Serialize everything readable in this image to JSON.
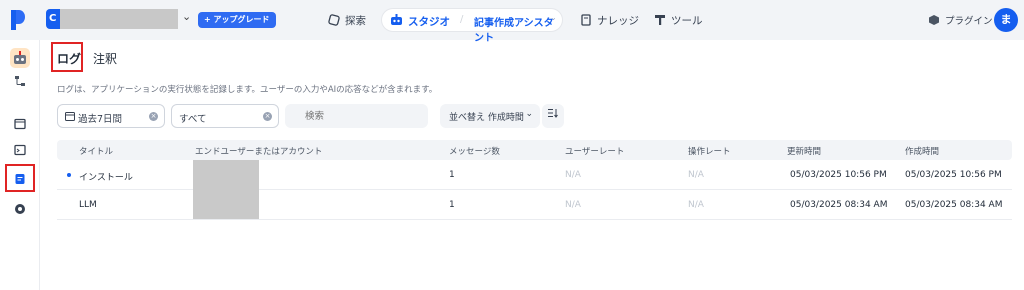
{
  "header": {
    "workspace_initial": "C",
    "upgrade_label": "+ アップグレード",
    "nav": {
      "explore": "探索",
      "studio": "スタジオ",
      "app_name": "記事作成アシスタント",
      "knowledge": "ナレッジ",
      "tools": "ツール",
      "plugins": "プラグイン"
    },
    "avatar_initial": "ま"
  },
  "tabs": [
    "ログ",
    "注釈"
  ],
  "description": "ログは、アプリケーションの実行状態を記録します。ユーザーの入力やAIの応答などが含まれます。",
  "filters": {
    "period": "過去7日間",
    "status": "すべて",
    "search_placeholder": "検索",
    "sort_label": "並べ替え 作成時間"
  },
  "table": {
    "columns": [
      "タイトル",
      "エンドユーザーまたはアカウント",
      "メッセージ数",
      "ユーザーレート",
      "操作レート",
      "更新時間",
      "作成時間"
    ],
    "rows": [
      {
        "title": "インストール",
        "user": "",
        "messages": "1",
        "user_rate": "N/A",
        "op_rate": "N/A",
        "updated": "05/03/2025 10:56 PM",
        "created": "05/03/2025 10:56 PM",
        "unread": true
      },
      {
        "title": "LLM",
        "user": "",
        "messages": "1",
        "user_rate": "N/A",
        "op_rate": "N/A",
        "updated": "05/03/2025 08:34 AM",
        "created": "05/03/2025 08:34 AM",
        "unread": false
      }
    ]
  },
  "colors": {
    "accent": "#155eef",
    "highlight": "#e02424"
  }
}
